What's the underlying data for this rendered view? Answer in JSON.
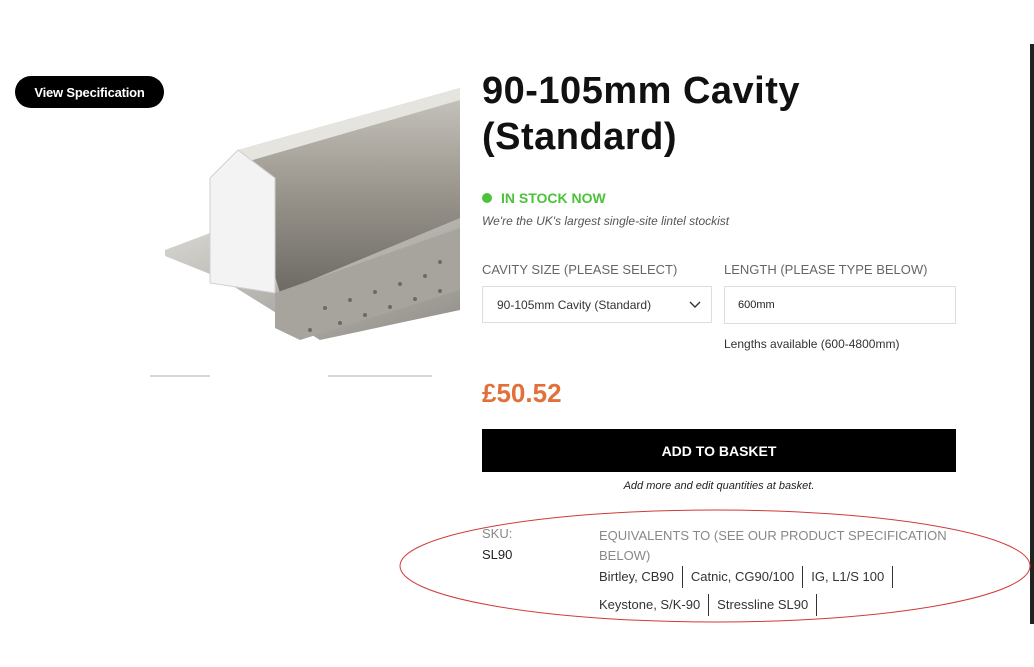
{
  "spec_button": {
    "label": "View Specification"
  },
  "product": {
    "title": "90-105mm Cavity (Standard)",
    "stock_status": "IN STOCK NOW",
    "tagline": "We're the UK's largest single-site lintel stockist",
    "price": "£50.52"
  },
  "options": {
    "cavity_label": "CAVITY SIZE (PLEASE SELECT)",
    "cavity_selected": "90-105mm Cavity (Standard)",
    "length_label": "LENGTH (PLEASE TYPE BELOW)",
    "length_value": "600mm",
    "length_helper": "Lengths available (600-4800mm)"
  },
  "basket": {
    "button_label": "ADD TO BASKET",
    "note": "Add more and edit quantities at basket."
  },
  "meta": {
    "sku_label": "SKU:",
    "sku_value": "SL90",
    "equivalents_label": "EQUIVALENTS TO (SEE OUR PRODUCT SPECIFICATION BELOW)",
    "equivalents": [
      "Birtley, CB90",
      "Catnic, CG90/100",
      "IG, L1/S 100",
      "Keystone, S/K-90",
      "Stressline SL90"
    ]
  },
  "colors": {
    "stock_green": "#4cc23a",
    "price_orange": "#e2703a",
    "annotation_red": "#d03a3a"
  }
}
